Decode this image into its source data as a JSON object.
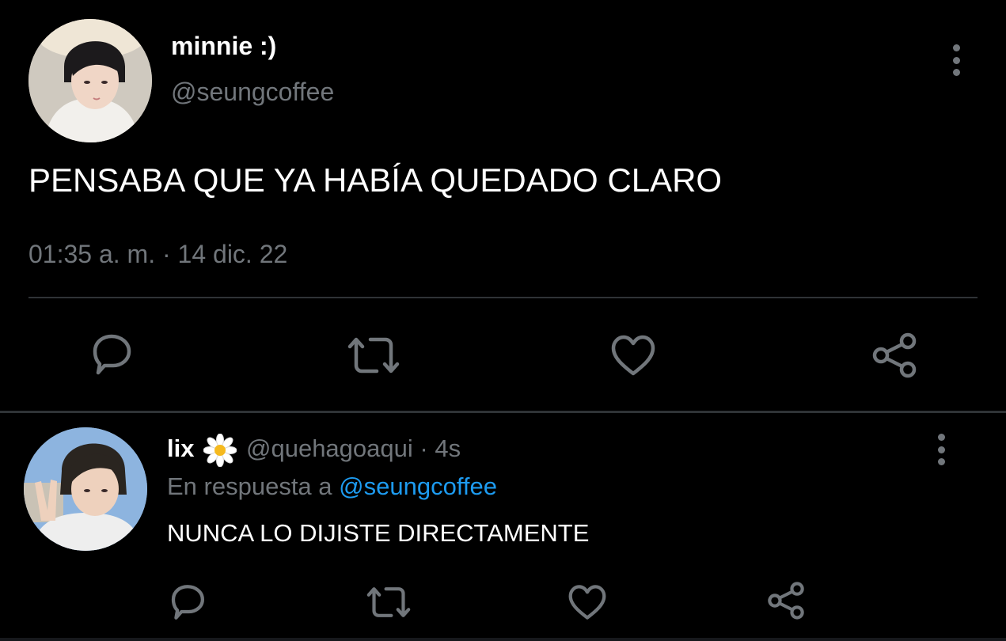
{
  "colors": {
    "background": "#000000",
    "primary_text": "#ffffff",
    "secondary_text": "#71767b",
    "link": "#1d9bf0",
    "divider": "#2f3336"
  },
  "main_tweet": {
    "author": {
      "display_name": "minnie :)",
      "handle": "@seungcoffee"
    },
    "text": "PENSABA QUE YA HABÍA QUEDADO CLARO",
    "timestamp": "01:35 a. m. · 14 dic. 22",
    "actions": [
      "reply-icon",
      "retweet-icon",
      "like-icon",
      "share-icon"
    ]
  },
  "reply": {
    "author": {
      "display_name": "lix",
      "emoji": "🌼",
      "handle": "@quehagoaqui",
      "time": "· 4s"
    },
    "replying_to_label": "En respuesta a",
    "replying_to_handle": "@seungcoffee",
    "text": "NUNCA LO DIJISTE DIRECTAMENTE",
    "actions": [
      "reply-icon",
      "retweet-icon",
      "like-icon",
      "share-icon"
    ]
  }
}
